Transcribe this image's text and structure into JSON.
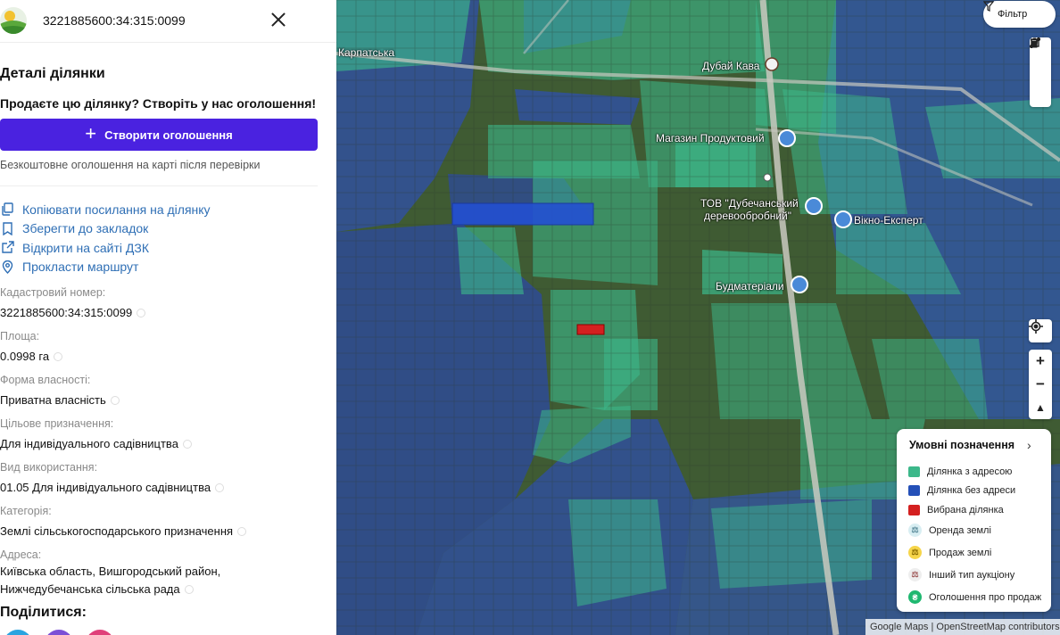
{
  "panel": {
    "cadastral_header": "3221885600:34:315:0099",
    "details_title": "Деталі ділянки",
    "sell_prompt": "Продаєте цю ділянку? Створіть у нас оголошення!",
    "create_button": "Створити оголошення",
    "free_note": "Безкоштовне оголошення на карті після перевірки",
    "actions": {
      "copy_link": "Копіювати посилання на ділянку",
      "bookmark": "Зберегти до закладок",
      "open_dzk": "Відкрити на сайті ДЗК",
      "route": "Прокласти маршрут"
    },
    "fields": {
      "cadastral": {
        "label": "Кадастровий номер:",
        "value": "3221885600:34:315:0099"
      },
      "area": {
        "label": "Площа:",
        "value": "0.0998 га"
      },
      "ownership": {
        "label": "Форма власності:",
        "value": "Приватна власність"
      },
      "purpose": {
        "label": "Цільове призначення:",
        "value": "Для індивідуального садівництва"
      },
      "usage": {
        "label": "Вид використання:",
        "value": "01.05 Для індивідуального садівництва"
      },
      "category": {
        "label": "Категорія:",
        "value": "Землі сільськогосподарського призначення"
      },
      "address": {
        "label": "Адреса:",
        "line1": "Київська область, Вишгородський район,",
        "line2": "Нижчедубечанська сільська рада"
      }
    },
    "share_title": "Поділитися:"
  },
  "map": {
    "filter_label": "Фільтр",
    "labels": {
      "street": "Карпатська",
      "cafe": "Дубай Кава",
      "shop": "Магазин Продуктовий",
      "company_line1": "ТОВ \"Дубечанський",
      "company_line2": "деревообробний\"",
      "vikno": "Вікно-Експерт",
      "budmat": "Будматеріали"
    },
    "legend": {
      "title": "Умовні позначення",
      "items": {
        "with_address": "Ділянка з адресою",
        "without_address": "Ділянка без адреси",
        "selected": "Вибрана ділянка",
        "rent": "Оренда землі",
        "sale": "Продаж землі",
        "other_auction": "Інший тип аукціону",
        "ads": "Оголошення про продаж"
      }
    },
    "attribution": "Google Maps | OpenStreetMap contributors"
  },
  "colors": {
    "accent": "#4a22e0",
    "link": "#2f6fb5",
    "parcel_with_address": "#3cb88a",
    "parcel_without_address": "#2450b8",
    "selected_parcel": "#d42020"
  }
}
